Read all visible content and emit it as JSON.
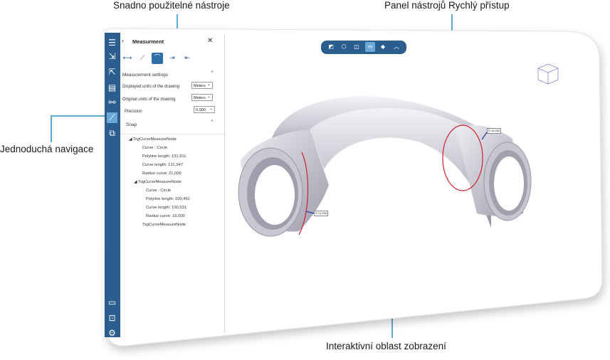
{
  "callouts": {
    "tools": "Snadno použitelné nástroje",
    "quick_panel": "Panel nástrojů Rychlý přístup",
    "navigation": "Jednoduchá navigace",
    "viewport": "Interaktivní oblast zobrazení"
  },
  "panel": {
    "title": "Measurment",
    "back_icon": "chevron-left-icon",
    "close_icon": "close-icon"
  },
  "settings": {
    "header": "Measurement settings",
    "displayed_units_label": "Displayed units of the drawing",
    "displayed_units_value": "Meters",
    "original_units_label": "Original units of the drawing",
    "original_units_value": "Meters",
    "precision_label": "Precision",
    "precision_value": "0,000"
  },
  "snap": {
    "label": "Snap"
  },
  "tree": {
    "nodes": [
      {
        "name": "TsgCurveMeasureNode",
        "props": [
          "Curve : Circle",
          "Polyline length: 131,911",
          "Curve length: 131,947",
          "Radius curve: 21,000"
        ]
      },
      {
        "name": "TsgCurveMeasureNode",
        "props": [
          "Curve : Circle",
          "Polyline length: 100,491",
          "Curve length: 100,531",
          "Radius curve: 16,000"
        ]
      },
      {
        "name": "TsgCurveMeasureNode",
        "props": []
      }
    ]
  },
  "model_labels": {
    "left": "R 21,000",
    "right": "R 16,000"
  },
  "colors": {
    "accent": "#2b5d8f",
    "highlight": "#5fa8d3",
    "selection": "#d0202a"
  }
}
